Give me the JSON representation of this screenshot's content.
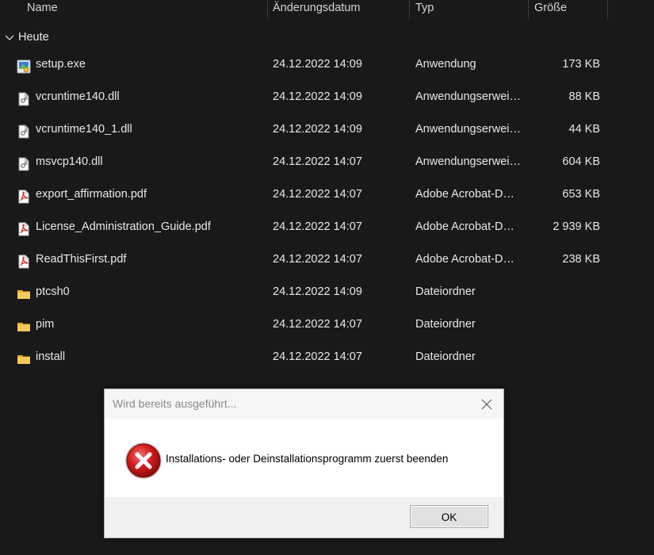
{
  "columns": {
    "name": "Name",
    "date": "Änderungsdatum",
    "type": "Typ",
    "size": "Größe"
  },
  "group": {
    "label": "Heute"
  },
  "files": [
    {
      "name": "setup.exe",
      "date": "24.12.2022 14:09",
      "type": "Anwendung",
      "size": "173 KB",
      "icon": "setup-exe-icon"
    },
    {
      "name": "vcruntime140.dll",
      "date": "24.12.2022 14:09",
      "type": "Anwendungserwei…",
      "size": "88 KB",
      "icon": "dll-file-icon"
    },
    {
      "name": "vcruntime140_1.dll",
      "date": "24.12.2022 14:09",
      "type": "Anwendungserwei…",
      "size": "44 KB",
      "icon": "dll-file-icon"
    },
    {
      "name": "msvcp140.dll",
      "date": "24.12.2022 14:07",
      "type": "Anwendungserwei…",
      "size": "604 KB",
      "icon": "dll-file-icon"
    },
    {
      "name": "export_affirmation.pdf",
      "date": "24.12.2022 14:07",
      "type": "Adobe Acrobat-D…",
      "size": "653 KB",
      "icon": "pdf-file-icon"
    },
    {
      "name": "License_Administration_Guide.pdf",
      "date": "24.12.2022 14:07",
      "type": "Adobe Acrobat-D…",
      "size": "2 939 KB",
      "icon": "pdf-file-icon"
    },
    {
      "name": "ReadThisFirst.pdf",
      "date": "24.12.2022 14:07",
      "type": "Adobe Acrobat-D…",
      "size": "238 KB",
      "icon": "pdf-file-icon"
    },
    {
      "name": "ptcsh0",
      "date": "24.12.2022 14:09",
      "type": "Dateiordner",
      "size": "",
      "icon": "folder-icon"
    },
    {
      "name": "pim",
      "date": "24.12.2022 14:07",
      "type": "Dateiordner",
      "size": "",
      "icon": "folder-icon"
    },
    {
      "name": "install",
      "date": "24.12.2022 14:07",
      "type": "Dateiordner",
      "size": "",
      "icon": "folder-icon"
    }
  ],
  "dialog": {
    "title": "Wird bereits ausgeführt...",
    "message": "Installations- oder Deinstallationsprogramm zuerst beenden",
    "ok_label": "OK",
    "icon": "error-icon"
  },
  "colors": {
    "background": "#191919",
    "text": "#e8e8e8",
    "folder": "#f2c14e",
    "pdf": "#d32f2f",
    "error": "#c8102e"
  }
}
